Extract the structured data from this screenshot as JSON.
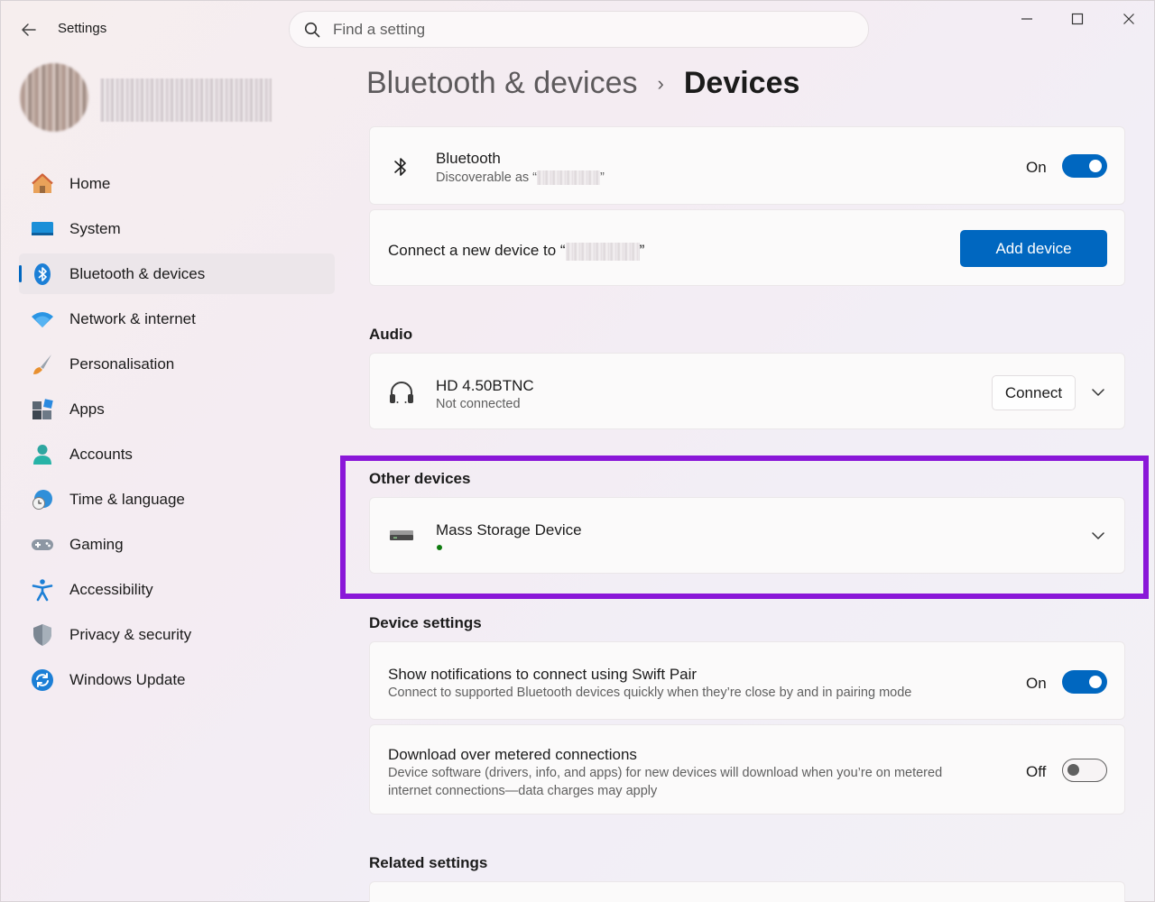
{
  "window": {
    "app_title": "Settings",
    "search_placeholder": "Find a setting"
  },
  "sidebar": {
    "items": [
      {
        "label": "Home",
        "icon": "home-icon"
      },
      {
        "label": "System",
        "icon": "system-icon"
      },
      {
        "label": "Bluetooth & devices",
        "icon": "bluetooth-icon",
        "active": true
      },
      {
        "label": "Network & internet",
        "icon": "wifi-icon"
      },
      {
        "label": "Personalisation",
        "icon": "brush-icon"
      },
      {
        "label": "Apps",
        "icon": "apps-icon"
      },
      {
        "label": "Accounts",
        "icon": "accounts-icon"
      },
      {
        "label": "Time & language",
        "icon": "clock-globe-icon"
      },
      {
        "label": "Gaming",
        "icon": "gamepad-icon"
      },
      {
        "label": "Accessibility",
        "icon": "accessibility-icon"
      },
      {
        "label": "Privacy & security",
        "icon": "shield-icon"
      },
      {
        "label": "Windows Update",
        "icon": "update-icon"
      }
    ]
  },
  "header": {
    "parent": "Bluetooth & devices",
    "separator": "›",
    "current": "Devices"
  },
  "bluetooth": {
    "title": "Bluetooth",
    "subtitle_prefix": "Discoverable as “",
    "subtitle_suffix": "”",
    "state_label": "On",
    "enabled": true
  },
  "connect_new": {
    "text_prefix": "Connect a new device to “",
    "text_suffix": "”",
    "button_label": "Add device"
  },
  "audio": {
    "section_title": "Audio",
    "device_name": "HD 4.50BTNC",
    "device_status": "Not connected",
    "connect_label": "Connect"
  },
  "other_devices": {
    "section_title": "Other devices",
    "device_name": "Mass Storage Device"
  },
  "device_settings": {
    "section_title": "Device settings",
    "swift_pair": {
      "title": "Show notifications to connect using Swift Pair",
      "description": "Connect to supported Bluetooth devices quickly when they’re close by and in pairing mode",
      "state_label": "On",
      "enabled": true
    },
    "metered": {
      "title": "Download over metered connections",
      "description_line1": "Device software (drivers, info, and apps) for new devices will download when you’re on metered",
      "description_line2": "internet connections—data charges may apply",
      "state_label": "Off",
      "enabled": false
    }
  },
  "related": {
    "section_title": "Related settings"
  },
  "colors": {
    "accent": "#0067c0",
    "highlight_box": "#8a17d8",
    "status_dot": "#0f7b0f"
  }
}
